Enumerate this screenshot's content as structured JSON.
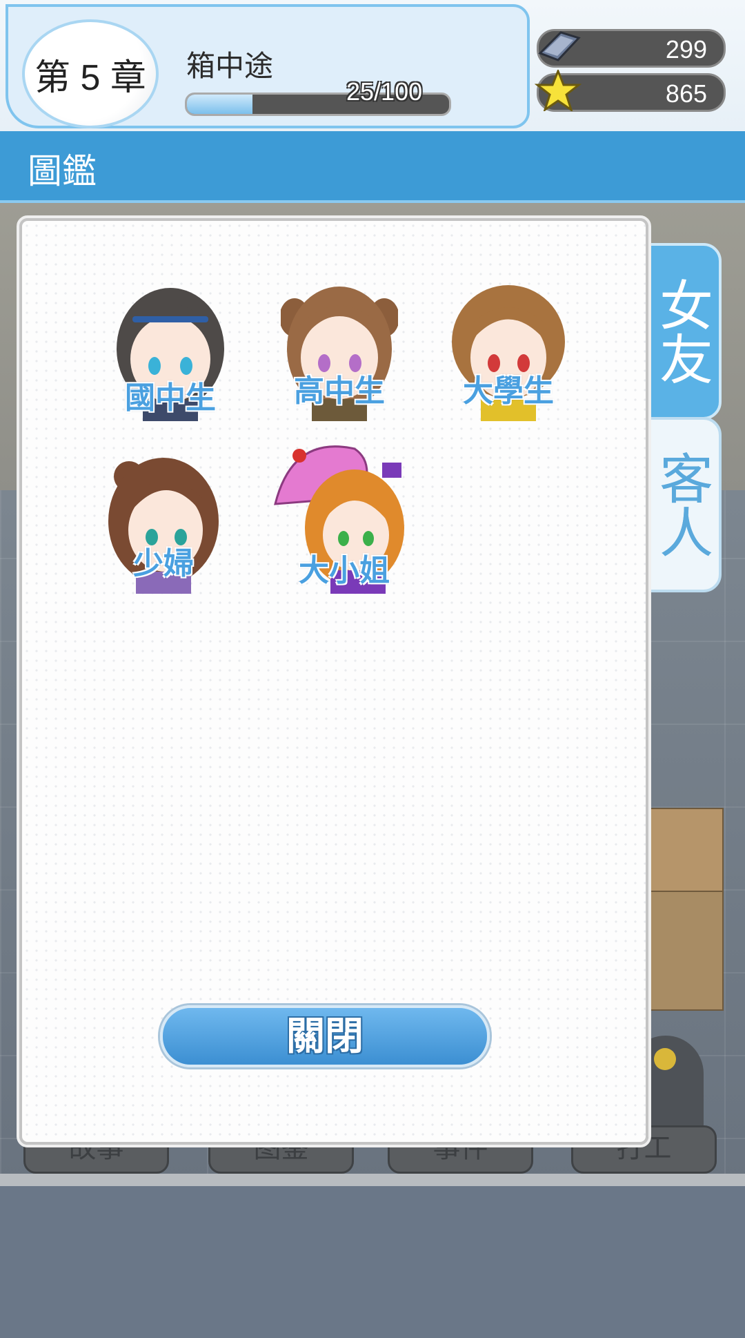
{
  "header": {
    "chapter_label": "第 5 章",
    "stage_title": "箱中途",
    "progress": {
      "current": 25,
      "max": 100,
      "text": "25/100"
    },
    "resources": [
      {
        "name": "tickets",
        "icon": "ticket-icon",
        "value": "299"
      },
      {
        "name": "stars",
        "icon": "star-icon",
        "value": "865"
      }
    ]
  },
  "title_bar": {
    "title": "圖鑑"
  },
  "side_tabs": [
    {
      "label": "女友",
      "active": true
    },
    {
      "label": "客人",
      "active": false
    }
  ],
  "characters": [
    {
      "name": "國中生",
      "icon": "junior-high-girl-portrait"
    },
    {
      "name": "高中生",
      "icon": "high-school-girl-portrait"
    },
    {
      "name": "大學生",
      "icon": "college-girl-portrait"
    },
    {
      "name": "少婦",
      "icon": "young-wife-portrait"
    },
    {
      "name": "大小姐",
      "icon": "young-lady-parasol-portrait"
    }
  ],
  "dialog": {
    "close_label": "關閉"
  },
  "background_buttons": [
    "故事",
    "图鉴",
    "事件",
    "打工"
  ],
  "colors": {
    "accent_blue": "#3d9bd6",
    "tab_blue": "#5ab2e6",
    "label_blue": "#4aa0e0"
  }
}
